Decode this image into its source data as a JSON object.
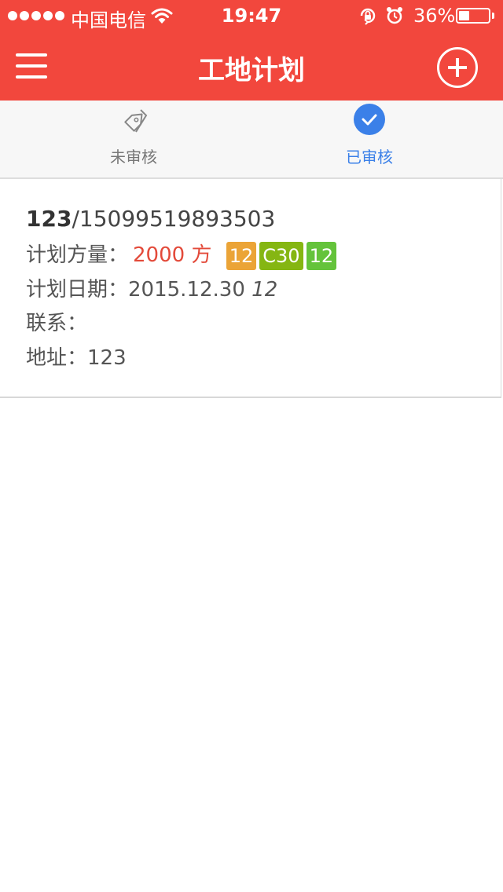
{
  "status_bar": {
    "carrier": "中国电信",
    "time": "19:47",
    "battery_percent": "36%",
    "battery_level": 0.36
  },
  "nav": {
    "title": "工地计划",
    "menu_icon": "hamburger-menu-icon",
    "add_icon": "plus-circle-icon"
  },
  "tabs": [
    {
      "label": "未审核",
      "icon": "tag-icon",
      "selected": false
    },
    {
      "label": "已审核",
      "icon": "check-circle-icon",
      "selected": true
    }
  ],
  "plans": [
    {
      "site_code": "123",
      "phone": "/15099519893503",
      "quantity_label": "计划方量：",
      "quantity": "2000 方",
      "tags": [
        "12",
        "C30",
        "12"
      ],
      "date_label": "计划日期：",
      "date": "2015.12.30",
      "time": "12",
      "contact_label": "联系：",
      "contact": "",
      "address_label": "地址：",
      "address": "123"
    }
  ],
  "colors": {
    "primary": "#f2473d",
    "tab_active": "#3b80e8",
    "quantity": "#e34a3a",
    "tag_orange": "#eba437",
    "tag_olive": "#85b612",
    "tag_green": "#64c33b"
  }
}
